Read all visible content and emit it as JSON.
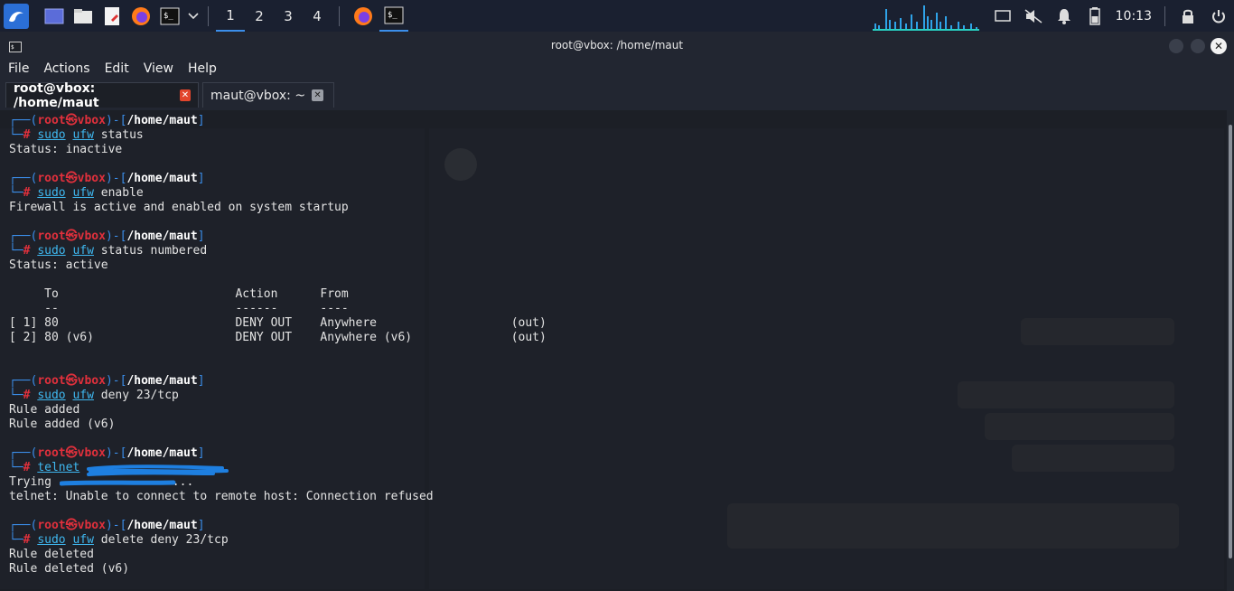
{
  "taskbar": {
    "workspaces": [
      "1",
      "2",
      "3",
      "4"
    ],
    "clock": "10:13"
  },
  "window": {
    "title": "root@vbox: /home/maut",
    "close_glyph": "✕"
  },
  "menu": [
    "File",
    "Actions",
    "Edit",
    "View",
    "Help"
  ],
  "tabs": [
    {
      "label": "root@vbox: /home/maut",
      "close": "✕"
    },
    {
      "label": "maut@vbox: ~",
      "close": "✕"
    }
  ],
  "prompt": {
    "open": "┌──(",
    "user": "root",
    "at": "㉿",
    "host": "vbox",
    "mid": ")-[",
    "path": "/home/maut",
    "close": "]",
    "second": "└─",
    "hash": "#"
  },
  "blocks": [
    {
      "cmd": "sudo",
      "prog": "ufw",
      "args": "status",
      "output": [
        "Status: inactive"
      ]
    },
    {
      "cmd": "sudo",
      "prog": "ufw",
      "args": "enable",
      "output": [
        "Firewall is active and enabled on system startup"
      ]
    },
    {
      "cmd": "sudo",
      "prog": "ufw",
      "args": "status numbered",
      "output": [
        "Status: active",
        "",
        "     To                         Action      From",
        "     --                         ------      ----",
        "[ 1] 80                         DENY OUT    Anywhere                   (out)",
        "[ 2] 80 (v6)                    DENY OUT    Anywhere (v6)              (out)",
        ""
      ]
    },
    {
      "cmd": "sudo",
      "prog": "ufw",
      "args": "deny 23/tcp",
      "output": [
        "Rule added",
        "Rule added (v6)"
      ]
    },
    {
      "cmd": "",
      "prog": "telnet",
      "args": "",
      "output": [
        "Trying ...",
        "telnet: Unable to connect to remote host: Connection refused"
      ]
    },
    {
      "cmd": "sudo",
      "prog": "ufw",
      "args": "delete deny 23/tcp",
      "output": [
        "Rule deleted",
        "Rule deleted (v6)"
      ]
    }
  ],
  "colors": {
    "prompt_frame": "#3b8eea",
    "prompt_user": "#e0303c",
    "command": "#3fb8f0",
    "text": "#e3e3e3",
    "terminal_bg": "#1c1f26",
    "tab_close_active": "#e2452c"
  }
}
